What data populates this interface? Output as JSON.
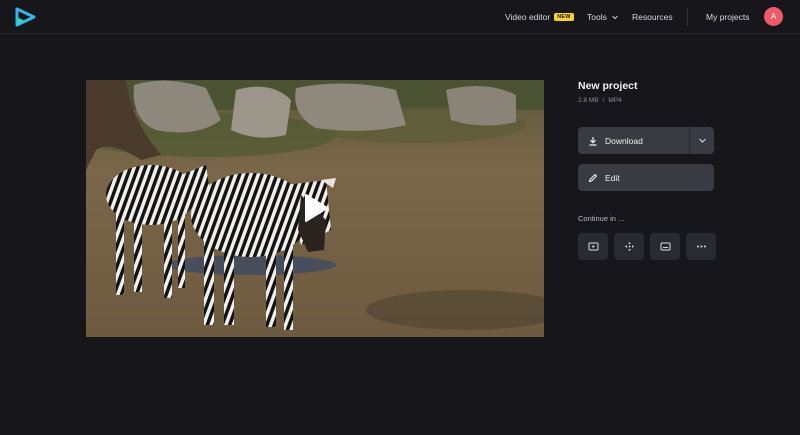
{
  "nav": {
    "video_editor": "Video editor",
    "badge": "NEW",
    "tools": "Tools",
    "resources": "Resources",
    "my_projects": "My projects",
    "avatar_initial": "A"
  },
  "project": {
    "title": "New project",
    "size": "2.8 MB",
    "separator": "/",
    "format": "MP4"
  },
  "actions": {
    "download": "Download",
    "edit": "Edit",
    "continue_in": "Continue in ..."
  },
  "colors": {
    "background": "#16161b",
    "button": "#3a3a42",
    "badge": "#f7d33a",
    "avatar": "#ef5a6a",
    "logo": "#37b4e8"
  },
  "icons": {
    "logo": "play-logo-icon",
    "download": "download-icon",
    "edit": "pencil-icon",
    "continue_tools": [
      "video-player-icon",
      "move-arrows-icon",
      "subtitles-icon",
      "more-dots-icon"
    ]
  }
}
